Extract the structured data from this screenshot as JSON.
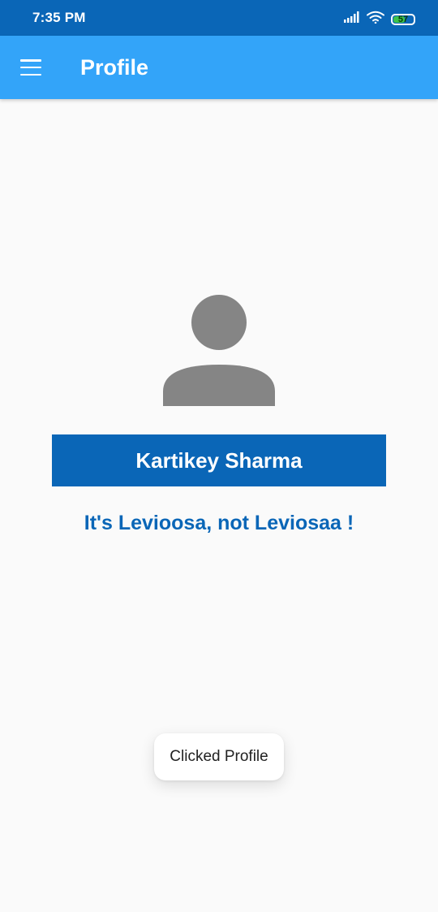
{
  "status_bar": {
    "time": "7:35 PM",
    "battery_level": "57",
    "icons": [
      "signal-icon",
      "wifi-icon",
      "battery-icon"
    ]
  },
  "app_bar": {
    "title": "Profile",
    "menu_icon": "hamburger-menu-icon"
  },
  "profile": {
    "avatar_icon": "person-avatar-icon",
    "name": "Kartikey Sharma",
    "quote": "It's Levioosa, not Leviosaa !"
  },
  "toast": {
    "message": "Clicked Profile"
  },
  "colors": {
    "status_bar": "#0a66b7",
    "app_bar": "#33a4f9",
    "banner": "#0a66b7",
    "quote_text": "#0a66b7",
    "avatar": "#858585",
    "background": "#fafafa",
    "battery": "#3cc34a"
  }
}
